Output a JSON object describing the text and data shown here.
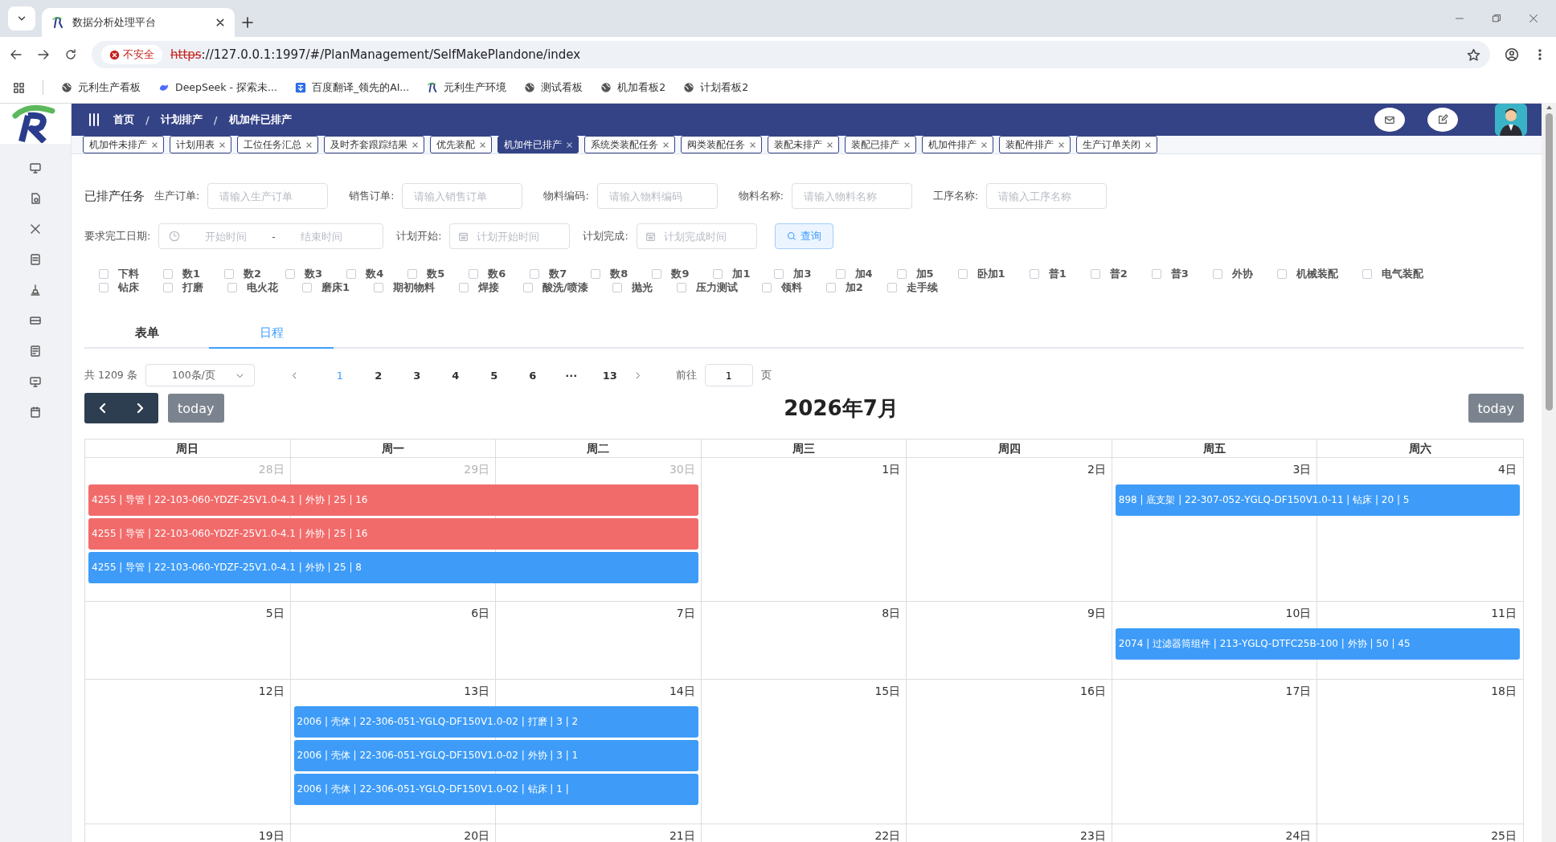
{
  "browser": {
    "tab_title": "数据分析处理平台",
    "insecure_label": "不安全",
    "url_scheme": "https",
    "url_rest": "://127.0.0.1:1997/#/PlanManagement/SelfMakePlandone/index",
    "bookmarks": [
      {
        "label": "元利生产看板",
        "kind": "globe"
      },
      {
        "label": "DeepSeek - 探索未...",
        "kind": "whale"
      },
      {
        "label": "百度翻译_领先的AI...",
        "kind": "translate"
      },
      {
        "label": "元利生产环境",
        "kind": "logo"
      },
      {
        "label": "测试看板",
        "kind": "globe"
      },
      {
        "label": "机加看板2",
        "kind": "globe"
      },
      {
        "label": "计划看板2",
        "kind": "globe"
      }
    ]
  },
  "breadcrumb": [
    "首页",
    "计划排产",
    "机加件已排产"
  ],
  "breadcrumb_separator": "/",
  "tags": [
    {
      "label": "机加件未排产",
      "selected": false
    },
    {
      "label": "计划用表",
      "selected": false
    },
    {
      "label": "工位任务汇总",
      "selected": false
    },
    {
      "label": "及时齐套跟踪结果",
      "selected": false
    },
    {
      "label": "优先装配",
      "selected": false
    },
    {
      "label": "机加件已排产",
      "selected": true
    },
    {
      "label": "系统类装配任务",
      "selected": false
    },
    {
      "label": "阀类装配任务",
      "selected": false
    },
    {
      "label": "装配未排产",
      "selected": false
    },
    {
      "label": "装配已排产",
      "selected": false
    },
    {
      "label": "机加件排产",
      "selected": false
    },
    {
      "label": "装配件排产",
      "selected": false
    },
    {
      "label": "生产订单关闭",
      "selected": false
    }
  ],
  "filters": {
    "title": "已排产任务",
    "fields": [
      {
        "label": "生产订单:",
        "placeholder": "请输入生产订单"
      },
      {
        "label": "销售订单:",
        "placeholder": "请输入销售订单"
      },
      {
        "label": "物料编码:",
        "placeholder": "请输入物料编码"
      },
      {
        "label": "物料名称:",
        "placeholder": "请输入物料名称"
      },
      {
        "label": "工序名称:",
        "placeholder": "请输入工序名称"
      }
    ],
    "date_range": {
      "label": "要求完工日期:",
      "start_placeholder": "开始时间",
      "separator": "-",
      "end_placeholder": "结束时间"
    },
    "plan_start": {
      "label": "计划开始:",
      "placeholder": "计划开始时间"
    },
    "plan_end": {
      "label": "计划完成:",
      "placeholder": "计划完成时间"
    },
    "query_button": "查询"
  },
  "process_rows": [
    [
      {
        "label": "下料",
        "checked": false
      },
      {
        "label": "数1",
        "checked": false
      },
      {
        "label": "数2",
        "checked": false
      },
      {
        "label": "数3",
        "checked": false
      },
      {
        "label": "数4",
        "checked": false
      },
      {
        "label": "数5",
        "checked": false
      },
      {
        "label": "数6",
        "checked": false
      },
      {
        "label": "数7",
        "checked": false
      },
      {
        "label": "数8",
        "checked": false
      },
      {
        "label": "数9",
        "checked": false
      },
      {
        "label": "加1",
        "checked": false
      },
      {
        "label": "加3",
        "checked": false
      },
      {
        "label": "加4",
        "checked": false
      },
      {
        "label": "加5",
        "checked": false
      },
      {
        "label": "卧加1",
        "checked": false
      },
      {
        "label": "普1",
        "checked": false
      },
      {
        "label": "普2",
        "checked": false
      },
      {
        "label": "普3",
        "checked": false
      },
      {
        "label": "外协",
        "checked": false
      },
      {
        "label": "机械装配",
        "checked": false
      },
      {
        "label": "电气装配",
        "checked": false
      }
    ],
    [
      {
        "label": "钻床",
        "checked": false
      },
      {
        "label": "打磨",
        "checked": false
      },
      {
        "label": "电火花",
        "checked": false
      },
      {
        "label": "磨床1",
        "checked": false
      },
      {
        "label": "期初物料",
        "checked": false
      },
      {
        "label": "焊接",
        "checked": false
      },
      {
        "label": "酸洗/喷漆",
        "checked": false
      },
      {
        "label": "抛光",
        "checked": false
      },
      {
        "label": "压力测试",
        "checked": false
      },
      {
        "label": "领料",
        "checked": false
      },
      {
        "label": "加2",
        "checked": false
      },
      {
        "label": "走手续",
        "checked": false
      }
    ]
  ],
  "view_tabs": [
    {
      "label": "表单",
      "selected": false
    },
    {
      "label": "日程",
      "selected": true
    }
  ],
  "pagination": {
    "total": "共 1209 条",
    "page_size": "100条/页",
    "pages": [
      {
        "label": "1",
        "selected": true
      },
      {
        "label": "2",
        "selected": false
      },
      {
        "label": "3",
        "selected": false
      },
      {
        "label": "4",
        "selected": false
      },
      {
        "label": "5",
        "selected": false
      },
      {
        "label": "6",
        "selected": false
      },
      {
        "label": "···",
        "selected": false
      },
      {
        "label": "13",
        "selected": false
      }
    ],
    "goto_label": "前往",
    "goto_value": "1",
    "goto_suffix": "页"
  },
  "calendar": {
    "today_left": "today",
    "title": "2026年7月",
    "today_right": "today",
    "weekdays": [
      "周日",
      "周一",
      "周二",
      "周三",
      "周四",
      "周五",
      "周六"
    ],
    "weeks": [
      {
        "days": [
          {
            "label": "28日",
            "muted": true
          },
          {
            "label": "29日",
            "muted": true
          },
          {
            "label": "30日",
            "muted": true
          },
          {
            "label": "1日",
            "muted": false
          },
          {
            "label": "2日",
            "muted": false
          },
          {
            "label": "3日",
            "muted": false
          },
          {
            "label": "4日",
            "muted": false
          }
        ],
        "events": [
          {
            "text": "4255 | 导管 | 22-103-060-YDZF-25V1.0-4.1 | 外协 | 25 | 16",
            "color": "#f26b6b"
          },
          {
            "text": "4255 | 导管 | 22-103-060-YDZF-25V1.0-4.1 | 外协 | 25 | 16",
            "color": "#f26b6b"
          },
          {
            "text": "4255 | 导管 | 22-103-060-YDZF-25V1.0-4.1 | 外协 | 25 | 8",
            "color": "#3e9cf8"
          },
          {
            "text": "898 | 底支架 | 22-307-052-YGLQ-DF150V1.0-11 | 钻床 | 20 | 5",
            "color": "#3e9cf8"
          }
        ]
      },
      {
        "days": [
          {
            "label": "5日",
            "muted": false
          },
          {
            "label": "6日",
            "muted": false
          },
          {
            "label": "7日",
            "muted": false
          },
          {
            "label": "8日",
            "muted": false
          },
          {
            "label": "9日",
            "muted": false
          },
          {
            "label": "10日",
            "muted": false
          },
          {
            "label": "11日",
            "muted": false
          }
        ],
        "events": [
          {
            "text": "2074 | 过滤器筒组件 | 213-YGLQ-DTFC25B-100 | 外协 | 50 | 45",
            "color": "#3e9cf8"
          }
        ]
      },
      {
        "days": [
          {
            "label": "12日",
            "muted": false
          },
          {
            "label": "13日",
            "muted": false
          },
          {
            "label": "14日",
            "muted": false
          },
          {
            "label": "15日",
            "muted": false
          },
          {
            "label": "16日",
            "muted": false
          },
          {
            "label": "17日",
            "muted": false
          },
          {
            "label": "18日",
            "muted": false
          }
        ],
        "events": [
          {
            "text": "2006 | 壳体 | 22-306-051-YGLQ-DF150V1.0-02 | 打磨 | 3 | 2",
            "color": "#3e9cf8"
          },
          {
            "text": "2006 | 壳体 | 22-306-051-YGLQ-DF150V1.0-02 | 外协 | 3 | 1",
            "color": "#3e9cf8"
          },
          {
            "text": "2006 | 壳体 | 22-306-051-YGLQ-DF150V1.0-02 | 钻床 | 1 |",
            "color": "#3e9cf8"
          }
        ]
      },
      {
        "days": [
          {
            "label": "19日",
            "muted": false
          },
          {
            "label": "20日",
            "muted": false
          },
          {
            "label": "21日",
            "muted": false
          },
          {
            "label": "22日",
            "muted": false
          },
          {
            "label": "23日",
            "muted": false
          },
          {
            "label": "24日",
            "muted": false
          },
          {
            "label": "25日",
            "muted": false
          }
        ]
      }
    ]
  }
}
